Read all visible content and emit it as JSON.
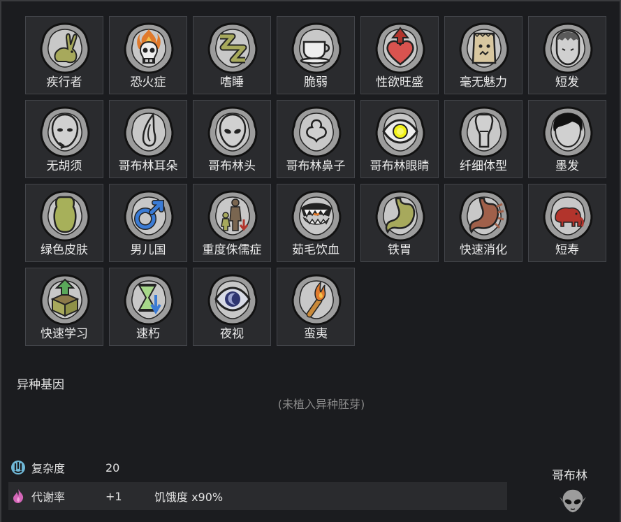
{
  "genes": [
    {
      "label": "疾行者",
      "icon": "rabbit-icon"
    },
    {
      "label": "恐火症",
      "icon": "flaming-skull-icon"
    },
    {
      "label": "嗜睡",
      "icon": "sleep-zzz-icon"
    },
    {
      "label": "脆弱",
      "icon": "teacup-icon"
    },
    {
      "label": "性欲旺盛",
      "icon": "heart-up-icon"
    },
    {
      "label": "毫无魅力",
      "icon": "paper-bag-icon"
    },
    {
      "label": "短发",
      "icon": "short-hair-icon"
    },
    {
      "label": "无胡须",
      "icon": "no-beard-icon"
    },
    {
      "label": "哥布林耳朵",
      "icon": "goblin-ear-icon"
    },
    {
      "label": "哥布林头",
      "icon": "goblin-head-icon"
    },
    {
      "label": "哥布林鼻子",
      "icon": "goblin-nose-icon"
    },
    {
      "label": "哥布林眼睛",
      "icon": "goblin-eye-icon"
    },
    {
      "label": "纤细体型",
      "icon": "thin-body-icon"
    },
    {
      "label": "墨发",
      "icon": "black-hair-icon"
    },
    {
      "label": "绿色皮肤",
      "icon": "green-skin-icon"
    },
    {
      "label": "男儿国",
      "icon": "male-symbol-icon"
    },
    {
      "label": "重度侏儒症",
      "icon": "dwarfism-icon"
    },
    {
      "label": "茹毛饮血",
      "icon": "fangs-icon"
    },
    {
      "label": "铁胃",
      "icon": "iron-stomach-icon"
    },
    {
      "label": "快速消化",
      "icon": "fast-digestion-icon"
    },
    {
      "label": "短寿",
      "icon": "elephant-icon"
    },
    {
      "label": "快速学习",
      "icon": "learning-box-icon"
    },
    {
      "label": "速朽",
      "icon": "hourglass-down-icon"
    },
    {
      "label": "夜视",
      "icon": "night-eye-icon"
    },
    {
      "label": "蛮夷",
      "icon": "torch-icon"
    }
  ],
  "xenogenes": {
    "title": "异种基因",
    "empty_text": "(未植入异种胚芽)"
  },
  "stats": {
    "complexity": {
      "label": "复杂度",
      "value": "20",
      "icon": "complexity-icon"
    },
    "metabolism": {
      "label": "代谢率",
      "value": "+1",
      "extra": "饥饿度 x90%",
      "icon": "metabolism-icon"
    }
  },
  "xenotype": {
    "name": "哥布林",
    "icon": "goblin-xenotype-icon"
  },
  "colors": {
    "cell_bg": "#2a2b2e",
    "cell_border": "#43454a",
    "badge_bg": "#9c9c9c",
    "goblin_green": "#a7b05a",
    "accent_blue": "#3a7bd5",
    "accent_red": "#b2342c"
  }
}
